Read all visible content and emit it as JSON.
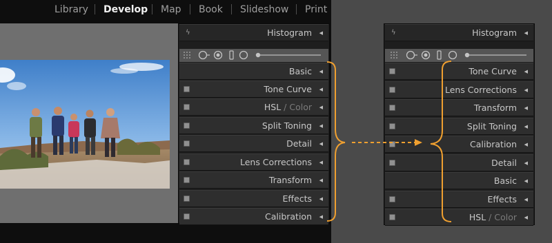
{
  "nav": [
    "Library",
    "Develop",
    "Map",
    "Book",
    "Slideshow",
    "Print"
  ],
  "nav_active": "Develop",
  "panel_header": "Histogram",
  "left_panel": [
    {
      "label": "Basic"
    },
    {
      "label": "Tone Curve"
    },
    {
      "label": "HSL",
      "suffix": " / Color"
    },
    {
      "label": "Split Toning"
    },
    {
      "label": "Detail"
    },
    {
      "label": "Lens Corrections"
    },
    {
      "label": "Transform"
    },
    {
      "label": "Effects"
    },
    {
      "label": "Calibration"
    }
  ],
  "right_panel": [
    {
      "label": "Tone Curve"
    },
    {
      "label": "Lens Corrections"
    },
    {
      "label": "Transform"
    },
    {
      "label": "Split Toning"
    },
    {
      "label": "Calibration"
    },
    {
      "label": "Detail"
    },
    {
      "label": "Basic"
    },
    {
      "label": "Effects"
    },
    {
      "label": "HSL",
      "suffix": " / Color"
    }
  ],
  "icons": {
    "collapse": "triangle-left-icon",
    "quick_develop": "lightning-icon",
    "tools": [
      "grid-overlay-icon",
      "crop-icon",
      "spot-removal-icon",
      "red-eye-icon",
      "graduated-filter-icon",
      "radial-filter-icon",
      "brush-icon"
    ]
  },
  "colors": {
    "accent": "#f0a030",
    "panel_row": "#2e2e2e",
    "app_background": "#0e0e0e"
  }
}
